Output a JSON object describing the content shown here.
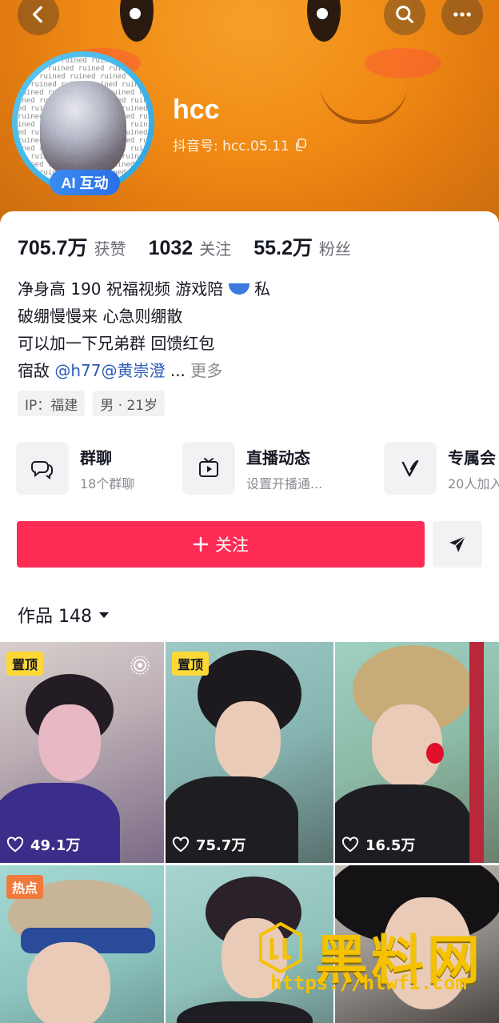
{
  "header": {
    "username": "hcc",
    "douyin_id_label": "抖音号: hcc.05.11",
    "ai_badge": "AI 互动",
    "avatar_pattern_text": "ed ruined ruined ruined ruined ruined ruined ruined ruined ruined ruined ruined ruined ruined ruined ruined ruined ruined ruined ruined ruined ruined ruined ruined ruined ruined ruined ruined ruined ruined ruined ruined ruined ruined ruined ruined ruined ruined ruined ruined ruined ruined ruined ruined ruined ruined ruined ruined ruined ruined ruined ruined ruined ruined ruined ruined ruined ruined ruined ruined ruined ruined ruined ruined ruined ruined ruined ruined ruined ruined ruined ruined ruined ruined ruined ruined ruined ruined ruined ruined ruined ruined ruined ruined ruined ruined ruined"
  },
  "stats": {
    "likes_num": "705.7万",
    "likes_label": "获赞",
    "following_num": "1032",
    "following_label": "关注",
    "followers_num": "55.2万",
    "followers_label": "粉丝"
  },
  "bio": {
    "line1_a": "净身高 190 祝福视频  游戏陪",
    "line1_b": " 私",
    "line2": "破绷慢慢来 心急则绷散",
    "line3": "可以加一下兄弟群 回馈红包",
    "line4_prefix": "宿敌 ",
    "line4_mention1": "@h77",
    "line4_mention2": "@黄崇澄",
    "line4_ellipsis": " ... ",
    "line4_more": "更多"
  },
  "tags": [
    "IP：福建",
    "男 · 21岁"
  ],
  "features": [
    {
      "icon": "chat-bubbles-icon",
      "title": "群聊",
      "sub": "18个群聊"
    },
    {
      "icon": "tv-play-icon",
      "title": "直播动态",
      "sub": "设置开播通..."
    },
    {
      "icon": "v-logo-icon",
      "title": "专属会",
      "sub": "20人加入"
    }
  ],
  "actions": {
    "follow_label": "关注",
    "follow_color": "#fe2c55"
  },
  "works": {
    "label": "作品 148"
  },
  "videos": [
    {
      "badge": "置顶",
      "badge_type": "top",
      "likes": "49.1万"
    },
    {
      "badge": "置顶",
      "badge_type": "top",
      "likes": "75.7万"
    },
    {
      "badge": "",
      "badge_type": "",
      "likes": "16.5万"
    },
    {
      "badge": "热点",
      "badge_type": "hot",
      "likes": ""
    },
    {
      "badge": "",
      "badge_type": "",
      "likes": ""
    },
    {
      "badge": "",
      "badge_type": "",
      "likes": ""
    }
  ],
  "watermark": {
    "title": "黑料网",
    "url": "https://hlwf1.com"
  }
}
